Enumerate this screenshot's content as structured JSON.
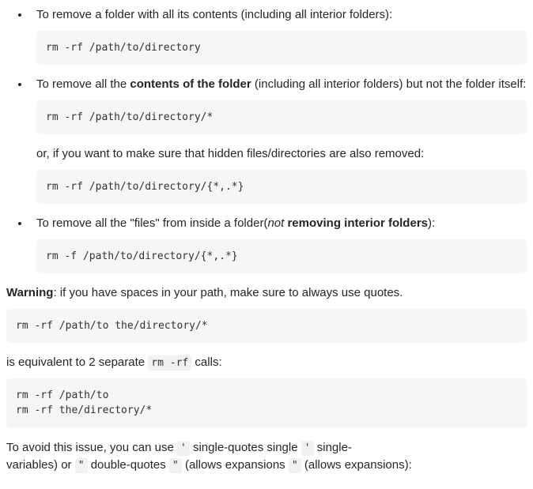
{
  "bullets": [
    {
      "text": "To remove a folder with all its contents (including all interior folders):",
      "code": "rm -rf /path/to/directory"
    },
    {
      "prefix": "To remove all the ",
      "bold": "contents of the folder",
      "suffix": " (including all interior folders) but not the folder itself:",
      "code": "rm -rf /path/to/directory/*",
      "or_text": "or, if you want to make sure that hidden files/directories are also removed:",
      "code2": "rm -rf /path/to/directory/{*,.*}"
    },
    {
      "prefix": "To remove all the \"files\" from inside a folder(",
      "em": "not",
      "bold": " removing interior folders",
      "suffix": "):",
      "code": "rm -f /path/to/directory/{*,.*}"
    }
  ],
  "warning": {
    "label": "Warning",
    "text": ": if you have spaces in your path, make sure to always use quotes."
  },
  "warn_code": "rm -rf /path/to the/directory/*",
  "equiv": {
    "before": "is equivalent to 2 separate ",
    "inline": "rm -rf",
    "after": " calls:"
  },
  "equiv_code": "rm -rf /path/to\nrm -rf the/directory/*",
  "avoid": {
    "t1": "To avoid this issue, you can use ",
    "sq": "'",
    "t2": " single-quotes",
    "t2b": "single ",
    "sq2": "'",
    "t3": " single-",
    "t4": "variables) or ",
    "dq": "\"",
    "t5": " double-quotes ",
    "dq2": "\"",
    "t6": " (allows expansions ",
    "dq3": "\"",
    "t7": " (allows expansions):"
  }
}
